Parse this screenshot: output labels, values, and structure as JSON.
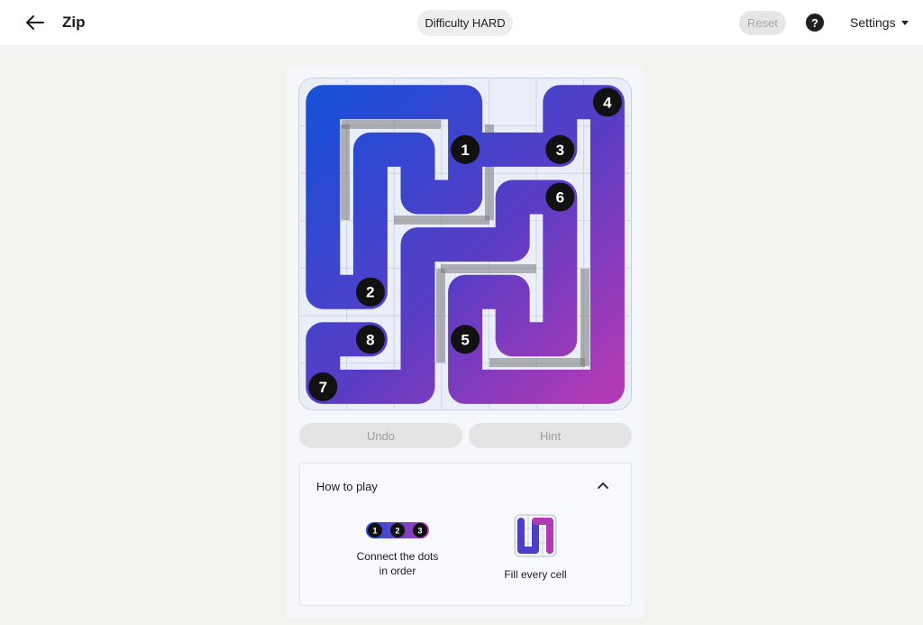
{
  "header": {
    "title": "Zip",
    "difficulty": "Difficulty HARD",
    "reset_label": "Reset",
    "help_label": "?",
    "settings_label": "Settings"
  },
  "game": {
    "grid_cols": 7,
    "grid_rows": 7,
    "path_order": [
      [
        4,
        1
      ],
      [
        3,
        1
      ],
      [
        3,
        0
      ],
      [
        2,
        0
      ],
      [
        1,
        0
      ],
      [
        0,
        0
      ],
      [
        0,
        1
      ],
      [
        0,
        2
      ],
      [
        0,
        3
      ],
      [
        0,
        4
      ],
      [
        1,
        4
      ],
      [
        1,
        3
      ],
      [
        1,
        2
      ],
      [
        1,
        1
      ],
      [
        2,
        1
      ],
      [
        2,
        2
      ],
      [
        3,
        2
      ],
      [
        3,
        1
      ],
      [
        4,
        1
      ],
      [
        5,
        1
      ],
      [
        5,
        0
      ],
      [
        6,
        0
      ],
      [
        6,
        1
      ],
      [
        6,
        2
      ],
      [
        6,
        3
      ],
      [
        6,
        4
      ],
      [
        6,
        5
      ],
      [
        6,
        6
      ],
      [
        5,
        6
      ],
      [
        4,
        6
      ],
      [
        3,
        6
      ],
      [
        3,
        5
      ],
      [
        3,
        4
      ],
      [
        4,
        4
      ],
      [
        4,
        5
      ],
      [
        5,
        5
      ],
      [
        5,
        4
      ],
      [
        5,
        3
      ],
      [
        5,
        2
      ],
      [
        4,
        2
      ],
      [
        4,
        3
      ],
      [
        3,
        3
      ],
      [
        2,
        3
      ],
      [
        2,
        4
      ],
      [
        2,
        5
      ],
      [
        2,
        6
      ],
      [
        1,
        6
      ],
      [
        0,
        6
      ],
      [
        0,
        5
      ],
      [
        1,
        5
      ]
    ],
    "numbered_dots": [
      {
        "label": "1",
        "cell": [
          3,
          1
        ]
      },
      {
        "label": "2",
        "cell": [
          1,
          4
        ]
      },
      {
        "label": "3",
        "cell": [
          5,
          1
        ]
      },
      {
        "label": "4",
        "cell": [
          6,
          0
        ]
      },
      {
        "label": "5",
        "cell": [
          3,
          5
        ]
      },
      {
        "label": "6",
        "cell": [
          5,
          2
        ]
      },
      {
        "label": "7",
        "cell": [
          0,
          6
        ]
      },
      {
        "label": "8",
        "cell": [
          1,
          5
        ]
      }
    ],
    "colors": {
      "path_start": "#1a4fd8",
      "path_mid": "#5b3cc4",
      "path_end": "#b03ab5",
      "dot": "#111111",
      "grid_bg": "#e9eef8",
      "wall": "#7a7a7a"
    }
  },
  "actions": {
    "undo_label": "Undo",
    "hint_label": "Hint"
  },
  "how_to_play": {
    "title": "How to play",
    "tip1_text": "Connect the dots in order",
    "tip1_dots": [
      "1",
      "2",
      "3"
    ],
    "tip2_text": "Fill every cell"
  }
}
